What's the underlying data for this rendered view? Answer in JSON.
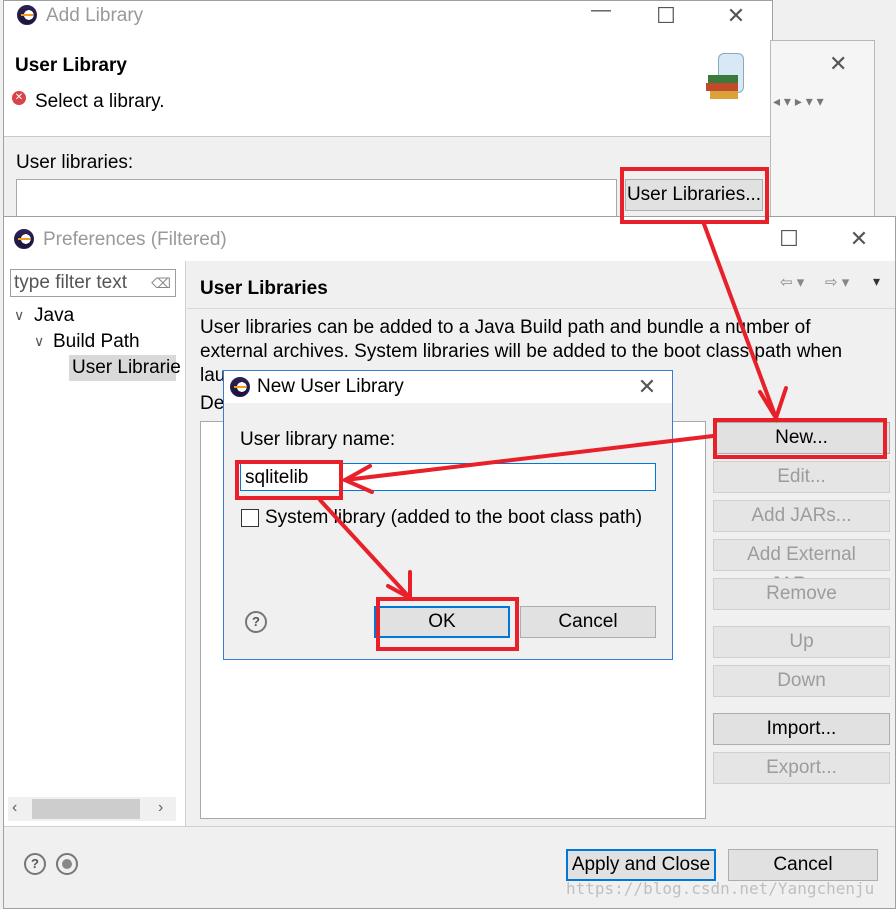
{
  "add_library": {
    "title": "Add Library",
    "section_title": "User Library",
    "message": "Select a library.",
    "user_libraries_label": "User libraries:",
    "user_libraries_button": "User Libraries..."
  },
  "preferences": {
    "title": "Preferences (Filtered)",
    "filter_placeholder": "type filter text",
    "tree": {
      "java": "Java",
      "build_path": "Build Path",
      "user_libraries": "User Librarie"
    },
    "page_title": "User Libraries",
    "description_line1": "User libraries can be added to a Java Build path and bundle a number of",
    "description_line2": "external archives. System libraries will be added to the boot class path when",
    "description_line3": "lau",
    "defined_label": "De",
    "buttons": {
      "new": "New...",
      "edit": "Edit...",
      "add_jars": "Add JARs...",
      "add_external_jars": "Add External JARs...",
      "remove": "Remove",
      "up": "Up",
      "down": "Down",
      "import": "Import...",
      "export": "Export..."
    },
    "apply_close": "Apply and Close",
    "cancel": "Cancel"
  },
  "new_user_library": {
    "title": "New User Library",
    "name_label": "User library name:",
    "name_value": "sqlitelib",
    "system_library_label": "System library (added to the boot class path)",
    "ok": "OK",
    "cancel": "Cancel"
  },
  "watermark": "https://blog.csdn.net/Yangchenju",
  "colors": {
    "annotation_red": "#e8202a",
    "focus_blue": "#0078d7"
  }
}
